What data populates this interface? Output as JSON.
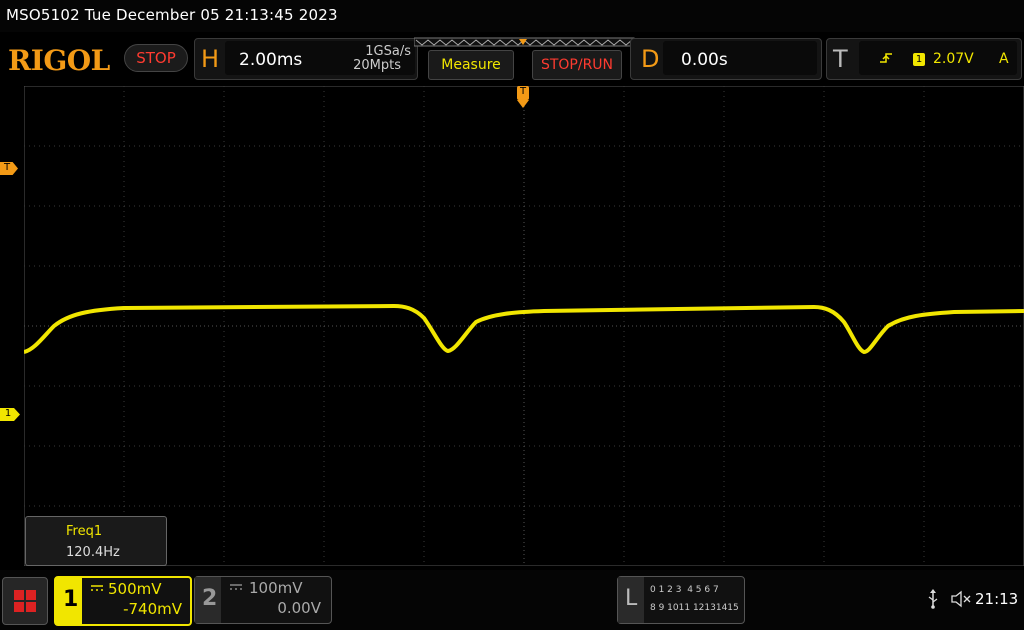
{
  "status_bar": {
    "title": "MSO5102  Tue December 05 21:13:45 2023"
  },
  "header": {
    "logo": "RIGOL",
    "run_state": "STOP",
    "horizontal": {
      "letter": "H",
      "timebase": "2.00ms",
      "sample_rate": "1GSa/s",
      "memory_depth": "20Mpts"
    },
    "measure_label": "Measure",
    "stop_run_label": "STOP/RUN",
    "delay": {
      "letter": "D",
      "value": "0.00s"
    },
    "trigger": {
      "letter": "T",
      "source": "1",
      "level": "2.07V",
      "mode": "A"
    }
  },
  "markers": {
    "trigger_position": "T",
    "trigger_level": "T",
    "ch1_ground": "1"
  },
  "measurement": {
    "name": "Freq1",
    "value": "120.4Hz"
  },
  "channels": [
    {
      "number": "1",
      "scale": "500mV",
      "offset": "-740mV",
      "color": "#f1e600"
    },
    {
      "number": "2",
      "scale": "100mV",
      "offset": "0.00V",
      "color": "#888888"
    }
  ],
  "logic": {
    "label": "L",
    "row1": "0 1 2 3  4 5 6 7",
    "row2": "8 9 1011 12131415"
  },
  "system": {
    "time": "21:13"
  },
  "colors": {
    "accent": "#f39a16",
    "ch1": "#f1e600",
    "stop": "#ff3b30"
  }
}
